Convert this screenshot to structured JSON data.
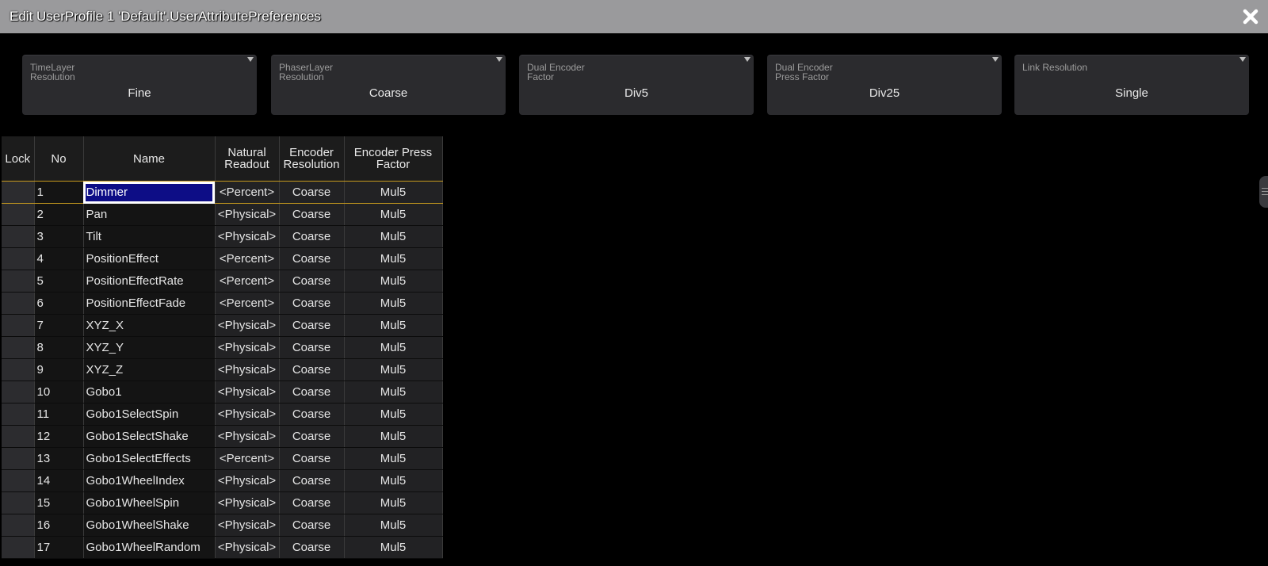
{
  "window": {
    "title": "Edit UserProfile 1 'Default'.UserAttributePreferences"
  },
  "prefs": [
    {
      "label": "TimeLayer\nResolution",
      "value": "Fine"
    },
    {
      "label": "PhaserLayer\nResolution",
      "value": "Coarse"
    },
    {
      "label": "Dual Encoder\nFactor",
      "value": "Div5"
    },
    {
      "label": "Dual Encoder\nPress Factor",
      "value": "Div25"
    },
    {
      "label": "Link Resolution",
      "value": "Single"
    }
  ],
  "table": {
    "headers": {
      "lock": "Lock",
      "no": "No",
      "name": "Name",
      "readout_1": "Natural",
      "readout_2": "Readout",
      "res_1": "Encoder",
      "res_2": "Resolution",
      "factor_1": "Encoder Press",
      "factor_2": "Factor"
    },
    "rows": [
      {
        "no": "1",
        "name": "Dimmer",
        "readout": "<Percent>",
        "resolution": "Coarse",
        "factor": "Mul5"
      },
      {
        "no": "2",
        "name": "Pan",
        "readout": "<Physical>",
        "resolution": "Coarse",
        "factor": "Mul5"
      },
      {
        "no": "3",
        "name": "Tilt",
        "readout": "<Physical>",
        "resolution": "Coarse",
        "factor": "Mul5"
      },
      {
        "no": "4",
        "name": "PositionEffect",
        "readout": "<Percent>",
        "resolution": "Coarse",
        "factor": "Mul5"
      },
      {
        "no": "5",
        "name": "PositionEffectRate",
        "readout": "<Percent>",
        "resolution": "Coarse",
        "factor": "Mul5"
      },
      {
        "no": "6",
        "name": "PositionEffectFade",
        "readout": "<Percent>",
        "resolution": "Coarse",
        "factor": "Mul5"
      },
      {
        "no": "7",
        "name": "XYZ_X",
        "readout": "<Physical>",
        "resolution": "Coarse",
        "factor": "Mul5"
      },
      {
        "no": "8",
        "name": "XYZ_Y",
        "readout": "<Physical>",
        "resolution": "Coarse",
        "factor": "Mul5"
      },
      {
        "no": "9",
        "name": "XYZ_Z",
        "readout": "<Physical>",
        "resolution": "Coarse",
        "factor": "Mul5"
      },
      {
        "no": "10",
        "name": "Gobo1",
        "readout": "<Physical>",
        "resolution": "Coarse",
        "factor": "Mul5"
      },
      {
        "no": "11",
        "name": "Gobo1SelectSpin",
        "readout": "<Physical>",
        "resolution": "Coarse",
        "factor": "Mul5"
      },
      {
        "no": "12",
        "name": "Gobo1SelectShake",
        "readout": "<Physical>",
        "resolution": "Coarse",
        "factor": "Mul5"
      },
      {
        "no": "13",
        "name": "Gobo1SelectEffects",
        "readout": "<Percent>",
        "resolution": "Coarse",
        "factor": "Mul5"
      },
      {
        "no": "14",
        "name": "Gobo1WheelIndex",
        "readout": "<Physical>",
        "resolution": "Coarse",
        "factor": "Mul5"
      },
      {
        "no": "15",
        "name": "Gobo1WheelSpin",
        "readout": "<Physical>",
        "resolution": "Coarse",
        "factor": "Mul5"
      },
      {
        "no": "16",
        "name": "Gobo1WheelShake",
        "readout": "<Physical>",
        "resolution": "Coarse",
        "factor": "Mul5"
      },
      {
        "no": "17",
        "name": "Gobo1WheelRandom",
        "readout": "<Physical>",
        "resolution": "Coarse",
        "factor": "Mul5"
      }
    ]
  },
  "icons": {
    "close": "close-icon",
    "side_handle": "menu-handle-icon"
  },
  "colors": {
    "selection": "#0d0d86",
    "header_underline": "#c79a1e",
    "titlebar": "#9a9a9c"
  }
}
